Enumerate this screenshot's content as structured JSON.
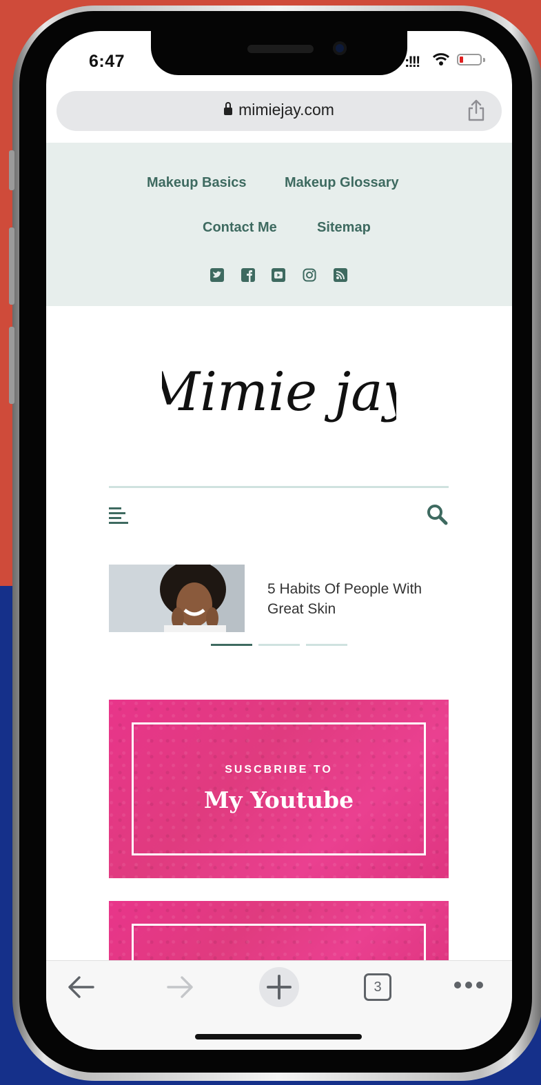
{
  "status_bar": {
    "time": "6:47",
    "signal": ":!!!"
  },
  "browser": {
    "url": "mimiejay.com"
  },
  "top_nav": {
    "links": [
      "Makeup Basics",
      "Makeup Glossary",
      "Contact Me",
      "Sitemap"
    ],
    "social_icons": [
      "twitter-icon",
      "facebook-icon",
      "youtube-icon",
      "instagram-icon",
      "rss-icon"
    ]
  },
  "site": {
    "logo_text": "Mimie jay"
  },
  "slider": {
    "title": "5 Habits Of People With Great Skin",
    "active_index": 0,
    "count": 3
  },
  "banners": [
    {
      "subtitle": "SUSCBRIBE TO",
      "title": "My Youtube"
    }
  ],
  "toolbar": {
    "tab_count": "3"
  },
  "colors": {
    "accent": "#3e6a60",
    "nav_bg": "#e7eeec",
    "banner_pink": "#e63a85"
  }
}
